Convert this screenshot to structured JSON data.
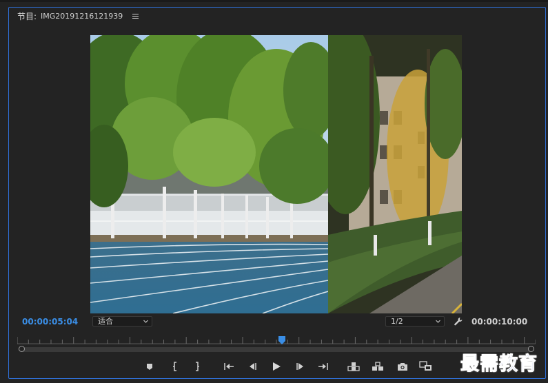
{
  "panel": {
    "title_prefix": "节目:",
    "clip_name": "IMG20191216121939",
    "menu_icon": "hamburger-menu-icon"
  },
  "timecode": {
    "current": "00:00:05:04",
    "duration": "00:00:10:00"
  },
  "zoom": {
    "selected": "适合"
  },
  "resolution": {
    "selected": "1/2"
  },
  "playhead_position_fraction": 0.51,
  "controls": [
    {
      "name": "add-marker-icon"
    },
    {
      "name": "mark-in-icon"
    },
    {
      "name": "mark-out-icon"
    },
    {
      "name": "go-to-in-icon"
    },
    {
      "name": "step-back-icon"
    },
    {
      "name": "play-icon"
    },
    {
      "name": "step-forward-icon"
    },
    {
      "name": "go-to-out-icon"
    },
    {
      "name": "lift-icon"
    },
    {
      "name": "extract-icon"
    },
    {
      "name": "export-frame-icon"
    },
    {
      "name": "comparison-view-icon"
    }
  ],
  "watermark": "最需教育",
  "colors": {
    "accent": "#3a8ee6",
    "panel_bg": "#232323",
    "border": "#2f6fd6"
  }
}
